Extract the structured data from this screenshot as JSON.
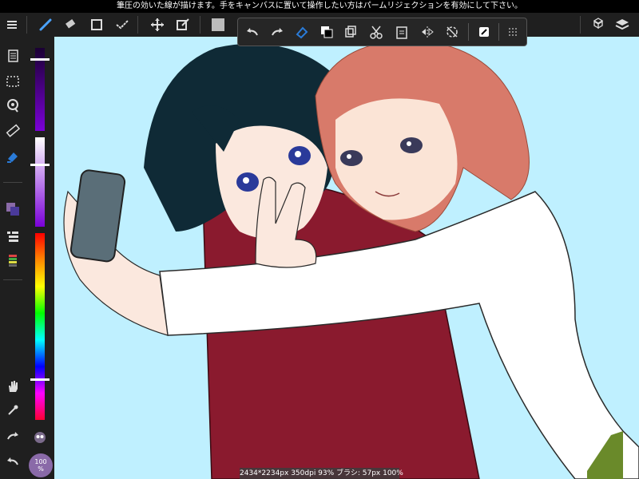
{
  "top_message": "筆圧の効いた線が描けます。手をキャンバスに置いて操作したい方はパームリジェクションを有効にして下さい。",
  "toolbar": {
    "items": [
      "menu-icon",
      "brush-icon",
      "eraser-icon",
      "rectangle-icon",
      "check-select-icon",
      "move-icon",
      "transform-icon",
      "color-swatch",
      "tile-icon",
      "layers-icon"
    ]
  },
  "popup_menu": {
    "items": [
      "undo-icon",
      "redo-icon",
      "fill-icon",
      "copy-icon",
      "duplicate-icon",
      "cut-icon",
      "paste-icon",
      "flip-icon",
      "rotate-icon",
      "transform-icon",
      "grid-icon"
    ]
  },
  "left_tools": {
    "items": [
      "layer-pages-icon",
      "selection-icon",
      "lasso-icon",
      "ruler-icon",
      "bucket-icon",
      "color-icon",
      "layer-list-icon",
      "palette-icon",
      "hand-icon",
      "eyedropper-icon",
      "redo-icon",
      "undo-icon"
    ]
  },
  "sliders": {
    "size_level": 0.13,
    "opacity_level": 0.7,
    "hue_level": 0.78
  },
  "zoom": {
    "line1": "100",
    "line2": "%"
  },
  "status": {
    "text": "2434*2234px 350dpi 93% ブラシ: 57px 100%"
  },
  "colors": {
    "canvas_bg": "#bff0ff",
    "ui_dark": "#1f1f1f",
    "accent_blue": "#2a7bd8"
  }
}
